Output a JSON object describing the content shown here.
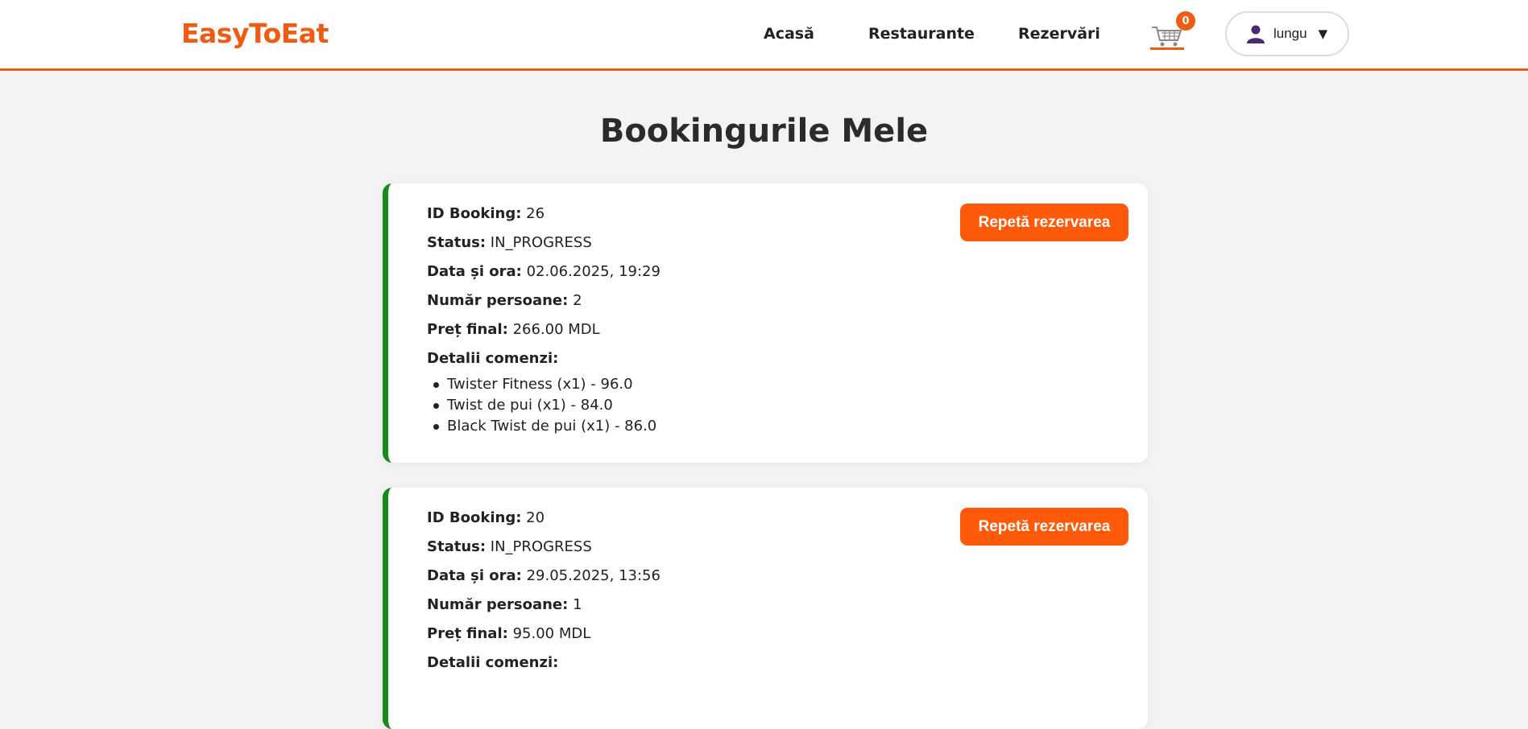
{
  "header": {
    "logo": "EasyToEat",
    "nav": {
      "home": "Acasă",
      "restaurants": "Restaurante",
      "bookings": "Rezervări"
    },
    "cart": {
      "count": "0",
      "icon": "cart-icon"
    },
    "user": {
      "name": "lungu",
      "caret": "▼",
      "icon": "user-icon"
    }
  },
  "page": {
    "title": "Bookingurile Mele"
  },
  "colors": {
    "accent": "#f05a12",
    "button": "#ff5a0a",
    "card_border": "#168a1a"
  },
  "labels": {
    "id": "ID Booking:",
    "status": "Status:",
    "datetime": "Data și ora:",
    "persons": "Număr persoane:",
    "price": "Preț final:",
    "details": "Detalii comenzi:",
    "repeat": "Repetă rezervarea"
  },
  "bookings": [
    {
      "id": "26",
      "status": "IN_PROGRESS",
      "datetime": "02.06.2025, 19:29",
      "persons": "2",
      "price": "266.00 MDL",
      "items": [
        "Twister Fitness (x1) - 96.0",
        "Twist de pui (x1) - 84.0",
        "Black Twist de pui (x1) - 86.0"
      ]
    },
    {
      "id": "20",
      "status": "IN_PROGRESS",
      "datetime": "29.05.2025, 13:56",
      "persons": "1",
      "price": "95.00 MDL",
      "items": []
    }
  ]
}
